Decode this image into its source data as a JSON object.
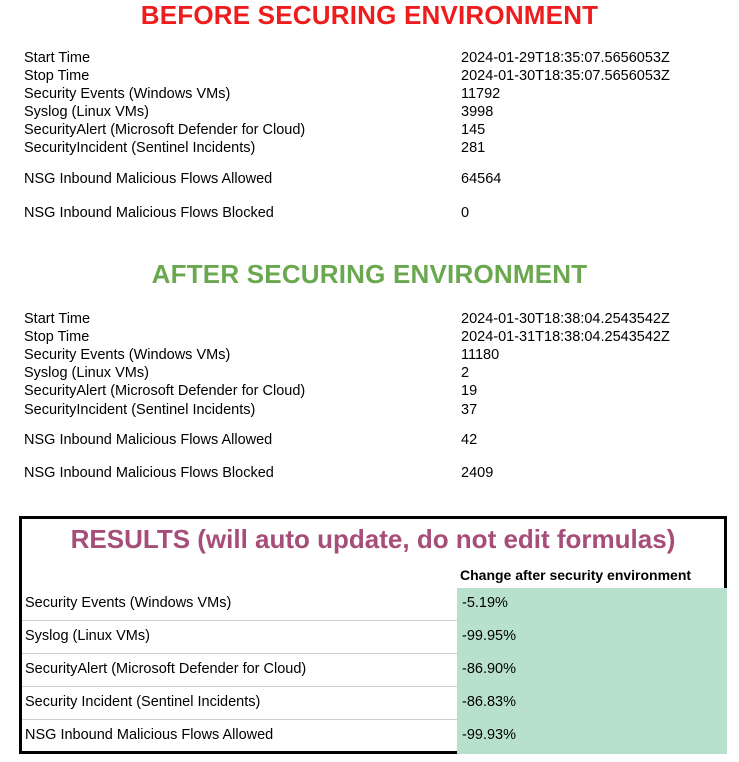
{
  "before": {
    "title": "BEFORE SECURING ENVIRONMENT",
    "rows": [
      {
        "label": "Start Time",
        "value": "2024-01-29T18:35:07.5656053Z"
      },
      {
        "label": "Stop Time",
        "value": "2024-01-30T18:35:07.5656053Z"
      },
      {
        "label": "Security Events (Windows VMs)",
        "value": "11792"
      },
      {
        "label": "Syslog (Linux VMs)",
        "value": "3998"
      },
      {
        "label": "SecurityAlert (Microsoft Defender for Cloud)",
        "value": "145"
      },
      {
        "label": "SecurityIncident (Sentinel Incidents)",
        "value": "281"
      },
      {
        "label": "NSG Inbound Malicious Flows Allowed",
        "value": "64564"
      },
      {
        "label": "NSG Inbound Malicious Flows Blocked",
        "value": "0"
      }
    ]
  },
  "after": {
    "title": "AFTER SECURING ENVIRONMENT",
    "rows": [
      {
        "label": "Start Time",
        "value": "2024-01-30T18:38:04.2543542Z"
      },
      {
        "label": "Stop Time",
        "value": "2024-01-31T18:38:04.2543542Z"
      },
      {
        "label": "Security Events (Windows VMs)",
        "value": "11180"
      },
      {
        "label": "Syslog (Linux VMs)",
        "value": "2"
      },
      {
        "label": "SecurityAlert (Microsoft Defender for Cloud)",
        "value": "19"
      },
      {
        "label": "SecurityIncident (Sentinel Incidents)",
        "value": "37"
      },
      {
        "label": "NSG Inbound Malicious Flows Allowed",
        "value": "42"
      },
      {
        "label": "NSG Inbound Malicious Flows Blocked",
        "value": "2409"
      }
    ]
  },
  "results": {
    "title": "RESULTS (will auto update, do not edit formulas)",
    "column_header": "Change after security environment",
    "highlight_color": "#b7e1cd",
    "rows": [
      {
        "label": "Security Events (Windows VMs)",
        "value": "-5.19%"
      },
      {
        "label": "Syslog (Linux VMs)",
        "value": "-99.95%"
      },
      {
        "label": "SecurityAlert (Microsoft Defender for Cloud)",
        "value": "-86.90%"
      },
      {
        "label": "Security Incident (Sentinel Incidents)",
        "value": "-86.83%"
      },
      {
        "label": "NSG Inbound Malicious Flows Allowed",
        "value": "-99.93%"
      }
    ]
  },
  "colors": {
    "before_title": "#ee1c1c",
    "after_title": "#6aa84f",
    "results_title": "#a64d79"
  }
}
